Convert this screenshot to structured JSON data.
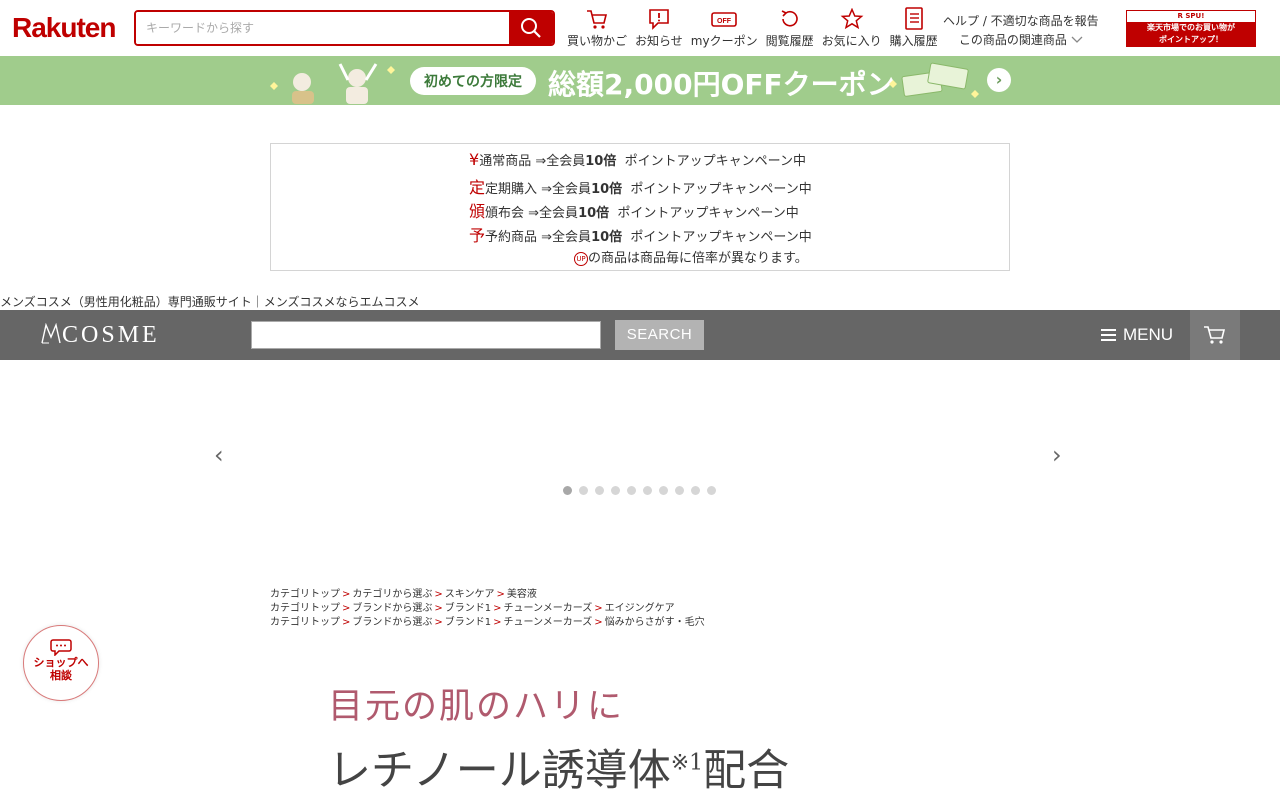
{
  "rakuten": {
    "logo": "Rakuten",
    "search_placeholder": "キーワードから探す",
    "nav": [
      {
        "label": "買い物かご",
        "icon": "cart-icon"
      },
      {
        "label": "お知らせ",
        "icon": "notification-icon"
      },
      {
        "label": "myクーポン",
        "icon": "coupon-icon"
      },
      {
        "label": "閲覧履歴",
        "icon": "history-icon"
      },
      {
        "label": "お気に入り",
        "icon": "star-icon"
      },
      {
        "label": "購入履歴",
        "icon": "purchase-list-icon"
      }
    ],
    "help_link": "ヘルプ / 不適切な商品を報告",
    "related_link": "この商品の関連商品",
    "spu_banner": {
      "top": "R SPU!",
      "line1": "楽天市場でのお買い物が",
      "line2": "ポイントアップ！"
    },
    "accent_color": "#bf0000"
  },
  "coupon_banner": {
    "pill": "初めての方限定",
    "text": "総額2,000円OFFクーポン",
    "bg_color": "#a0cc8c"
  },
  "points_box": {
    "rows": [
      {
        "tag": "¥",
        "label": "通常商品",
        "text": " ⇒全会員",
        "bold": "10倍",
        "tail": "  ポイントアップキャンペーン中"
      },
      {
        "tag": "定",
        "label": "定期購入",
        "text": " ⇒全会員",
        "bold": "10倍",
        "tail": "  ポイントアップキャンペーン中"
      },
      {
        "tag": "頒",
        "label": "頒布会",
        "text": " ⇒全会員",
        "bold": "10倍",
        "tail": "  ポイントアップキャンペーン中"
      },
      {
        "tag": "予",
        "label": "予約商品",
        "text": " ⇒全会員",
        "bold": "10倍",
        "tail": "  ポイントアップキャンペーン中"
      }
    ],
    "note_icon": "UP",
    "note": "の商品は商品毎に倍率が異なります。"
  },
  "site_description": "メンズコスメ（男性用化粧品）専門通販サイト｜メンズコスメならエムコスメ",
  "mcosme": {
    "logo": "COSME",
    "search_button": "SEARCH",
    "menu_label": "MENU",
    "bar_color": "#666666"
  },
  "carousel": {
    "prev": "‹",
    "next": "›",
    "slide_count": 10,
    "active_index": 0
  },
  "breadcrumbs": [
    [
      "カテゴリトップ",
      "カテゴリから選ぶ",
      "スキンケア",
      "美容液"
    ],
    [
      "カテゴリトップ",
      "ブランドから選ぶ",
      "ブランド1",
      "チューンメーカーズ",
      "エイジングケア"
    ],
    [
      "カテゴリトップ",
      "ブランドから選ぶ",
      "ブランド1",
      "チューンメーカーズ",
      "悩みからさがす・毛穴"
    ]
  ],
  "chat_button": {
    "line1": "ショップへ",
    "line2": "相談"
  },
  "hero": {
    "line1": "目元の肌のハリに",
    "line2_main": "レチノール誘導体",
    "line2_sup": "※1",
    "line2_tail": "配合"
  }
}
